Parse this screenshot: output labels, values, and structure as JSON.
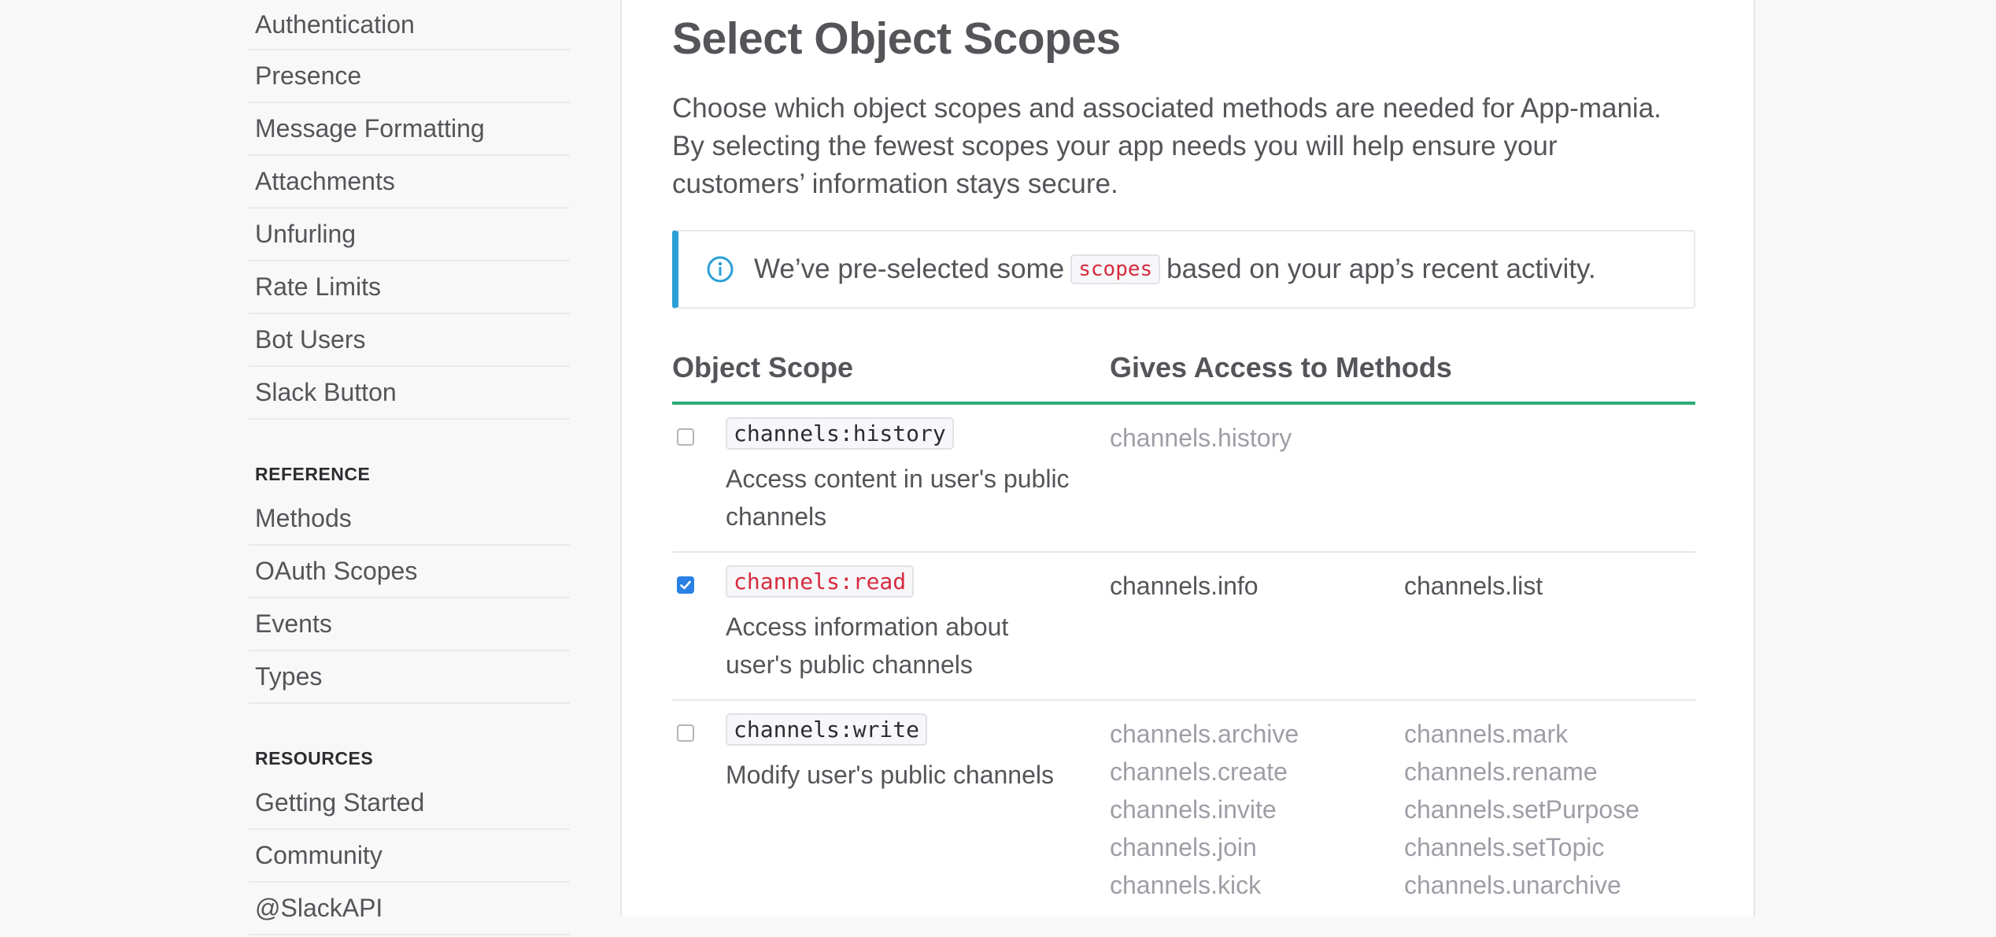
{
  "sidebar": {
    "items_top": [
      "Authentication",
      "Presence",
      "Message Formatting",
      "Attachments",
      "Unfurling",
      "Rate Limits",
      "Bot Users",
      "Slack Button"
    ],
    "reference_heading": "REFERENCE",
    "reference_items": [
      "Methods",
      "OAuth Scopes",
      "Events",
      "Types"
    ],
    "resources_heading": "RESOURCES",
    "resources_items": [
      "Getting Started",
      "Community",
      "@SlackAPI"
    ]
  },
  "main": {
    "title": "Select Object Scopes",
    "intro": "Choose which object scopes and associated methods are needed for App-mania. By selecting the fewest scopes your app needs you will help ensure your customers’ information stays secure.",
    "callout": {
      "icon": "info-icon",
      "text_before": "We’ve pre-selected some",
      "code": "scopes",
      "text_after": "based on your app’s recent activity.",
      "accent": "#2a9fd6"
    },
    "table": {
      "col_scope": "Object Scope",
      "col_methods": "Gives Access to Methods",
      "header_rule_color": "#2bac76",
      "rows": [
        {
          "scope": "channels:history",
          "checked": false,
          "description": "Access content in user's public channels",
          "methods_col1": [
            "channels.history"
          ],
          "methods_col2": []
        },
        {
          "scope": "channels:read",
          "checked": true,
          "description": "Access information about user's public channels",
          "methods_col1": [
            "channels.info"
          ],
          "methods_col2": [
            "channels.list"
          ]
        },
        {
          "scope": "channels:write",
          "checked": false,
          "description": "Modify user's public channels",
          "methods_col1": [
            "channels.archive",
            "channels.create",
            "channels.invite",
            "channels.join",
            "channels.kick"
          ],
          "methods_col2": [
            "channels.mark",
            "channels.rename",
            "channels.setPurpose",
            "channels.setTopic",
            "channels.unarchive"
          ]
        }
      ]
    }
  }
}
